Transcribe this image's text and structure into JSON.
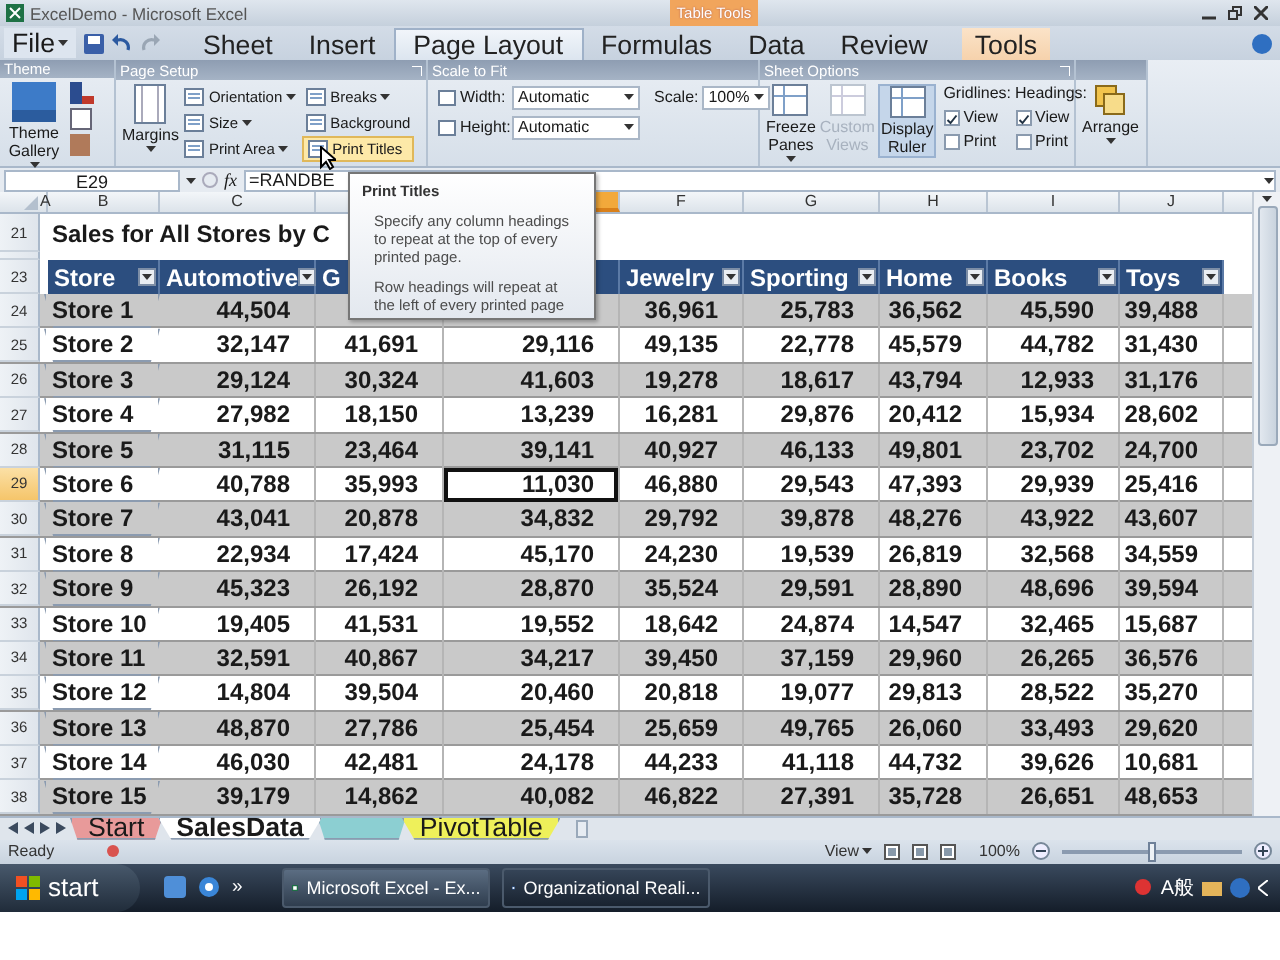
{
  "window": {
    "title": "ExcelDemo - Microsoft Excel",
    "context_label": "Table Tools"
  },
  "file_menu": "File",
  "tabs": [
    {
      "label": "Sheet",
      "kind": "normal",
      "selected": false
    },
    {
      "label": "Insert",
      "kind": "normal",
      "selected": false
    },
    {
      "label": "Page Layout",
      "kind": "normal",
      "selected": true
    },
    {
      "label": "Formulas",
      "kind": "normal",
      "selected": false
    },
    {
      "label": "Data",
      "kind": "normal",
      "selected": false
    },
    {
      "label": "Review",
      "kind": "normal",
      "selected": false
    },
    {
      "label": "Tools",
      "kind": "contextual",
      "selected": false
    }
  ],
  "ribbon": {
    "theme": {
      "label": "Theme",
      "gallery": "Theme Gallery"
    },
    "page_setup": {
      "label": "Page Setup",
      "margins": "Margins",
      "items": [
        {
          "label": "Orientation",
          "dropdown": true,
          "hovered": false
        },
        {
          "label": "Size",
          "dropdown": true,
          "hovered": false
        },
        {
          "label": "Print Area",
          "dropdown": true,
          "hovered": false
        },
        {
          "label": "Breaks",
          "dropdown": true,
          "hovered": false
        },
        {
          "label": "Background",
          "dropdown": false,
          "hovered": false
        },
        {
          "label": "Print Titles",
          "dropdown": false,
          "hovered": true
        }
      ]
    },
    "scale_to_fit": {
      "label": "Scale to Fit",
      "width_label": "Width:",
      "width": "Automatic",
      "height_label": "Height:",
      "height": "Automatic",
      "scale_label": "Scale:",
      "scale": "100%"
    },
    "sheet_options": {
      "label": "Sheet Options",
      "buttons": [
        {
          "label": "Freeze Panes",
          "dropdown": true,
          "disabled": false,
          "selected": false
        },
        {
          "label": "Custom Views",
          "dropdown": false,
          "disabled": true,
          "selected": false
        },
        {
          "label": "Display Ruler",
          "dropdown": false,
          "disabled": false,
          "selected": true
        }
      ],
      "gridlines": {
        "label": "Gridlines:",
        "view": {
          "label": "View",
          "checked": true
        },
        "print": {
          "label": "Print",
          "checked": false
        }
      },
      "headings": {
        "label": "Headings:",
        "view": {
          "label": "View",
          "checked": true
        },
        "print": {
          "label": "Print",
          "checked": false
        }
      }
    },
    "arrange": {
      "label": "Arrange"
    }
  },
  "formula_bar": {
    "name_box": "E29",
    "function_label": "fx",
    "formula": "=RANDBE"
  },
  "tooltip": {
    "title": "Print Titles",
    "paragraphs": [
      "Specify any column headings to repeat at the top of every printed page.",
      "Row headings will repeat at the left of every printed page"
    ]
  },
  "sheet": {
    "columns": [
      {
        "letter": "A",
        "selected": false
      },
      {
        "letter": "B",
        "header": "Store",
        "selected": false
      },
      {
        "letter": "C",
        "header": "Automotive",
        "selected": false
      },
      {
        "header": "G",
        "selected": false
      },
      {
        "selected": true
      },
      {
        "letter": "F",
        "header": "Jewelry",
        "selected": false
      },
      {
        "letter": "G",
        "header": "Sporting",
        "selected": false
      },
      {
        "letter": "H",
        "header": "Home",
        "selected": false
      },
      {
        "letter": "I",
        "header": "Books",
        "selected": false
      },
      {
        "letter": "J",
        "header": "Toys",
        "selected": false
      }
    ],
    "title_row": "21",
    "title": "Sales for All Stores by C",
    "header_row": "23",
    "rows": [
      {
        "number": "24",
        "selected": false,
        "covered_by_tooltip": true,
        "store": "Store 1",
        "values": [
          "44,504",
          "36,961",
          "25,783",
          "36,562",
          "45,590",
          "39,488"
        ]
      },
      {
        "number": "25",
        "selected": false,
        "store": "Store 2",
        "values": [
          "32,147",
          "41,691",
          "29,116",
          "49,135",
          "22,778",
          "45,579",
          "44,782",
          "31,430"
        ]
      },
      {
        "number": "26",
        "selected": false,
        "store": "Store 3",
        "values": [
          "29,124",
          "30,324",
          "41,603",
          "19,278",
          "18,617",
          "43,794",
          "12,933",
          "31,176"
        ]
      },
      {
        "number": "27",
        "selected": false,
        "store": "Store 4",
        "values": [
          "27,982",
          "18,150",
          "13,239",
          "16,281",
          "29,876",
          "20,412",
          "15,934",
          "28,602"
        ]
      },
      {
        "number": "28",
        "selected": false,
        "store": "Store 5",
        "values": [
          "31,115",
          "23,464",
          "39,141",
          "40,927",
          "46,133",
          "49,801",
          "23,702",
          "24,700"
        ]
      },
      {
        "number": "29",
        "selected": true,
        "store": "Store 6",
        "values": [
          "40,788",
          "35,993",
          "11,030",
          "46,880",
          "29,543",
          "47,393",
          "29,939",
          "25,416"
        ]
      },
      {
        "number": "30",
        "selected": false,
        "store": "Store 7",
        "values": [
          "43,041",
          "20,878",
          "34,832",
          "29,792",
          "39,878",
          "48,276",
          "43,922",
          "43,607"
        ]
      },
      {
        "number": "31",
        "selected": false,
        "store": "Store 8",
        "values": [
          "22,934",
          "17,424",
          "45,170",
          "24,230",
          "19,539",
          "26,819",
          "32,568",
          "34,559"
        ]
      },
      {
        "number": "32",
        "selected": false,
        "store": "Store 9",
        "values": [
          "45,323",
          "26,192",
          "28,870",
          "35,524",
          "29,591",
          "28,890",
          "48,696",
          "39,594"
        ]
      },
      {
        "number": "33",
        "selected": false,
        "store": "Store 10",
        "values": [
          "19,405",
          "41,531",
          "19,552",
          "18,642",
          "24,874",
          "14,547",
          "32,465",
          "15,687"
        ]
      },
      {
        "number": "34",
        "selected": false,
        "store": "Store 11",
        "values": [
          "32,591",
          "40,867",
          "34,217",
          "39,450",
          "37,159",
          "29,960",
          "26,265",
          "36,576"
        ]
      },
      {
        "number": "35",
        "selected": false,
        "store": "Store 12",
        "values": [
          "14,804",
          "39,504",
          "20,460",
          "20,818",
          "19,077",
          "29,813",
          "28,522",
          "35,270"
        ]
      },
      {
        "number": "36",
        "selected": false,
        "store": "Store 13",
        "values": [
          "48,870",
          "27,786",
          "25,454",
          "25,659",
          "49,765",
          "26,060",
          "33,493",
          "29,620"
        ]
      },
      {
        "number": "37",
        "selected": false,
        "store": "Store 14",
        "values": [
          "46,030",
          "42,481",
          "24,178",
          "44,233",
          "41,118",
          "44,732",
          "39,626",
          "10,681"
        ]
      },
      {
        "number": "38",
        "selected": false,
        "store": "Store 15",
        "values": [
          "39,179",
          "14,862",
          "40,082",
          "46,822",
          "27,391",
          "35,728",
          "26,651",
          "48,653"
        ]
      }
    ]
  },
  "sheet_tabs": [
    {
      "label": "Start",
      "color": "#e89a9a",
      "selected": false
    },
    {
      "label": "SalesData",
      "color": "#ffffff",
      "selected": true
    },
    {
      "color": "#8ccfd2",
      "selected": false
    },
    {
      "label": "PivotTable",
      "color": "#eef05a",
      "selected": false
    }
  ],
  "status_bar": {
    "text": "Ready",
    "view_label": "View",
    "zoom": "100%",
    "zoom_slider": {
      "level": 0.5
    }
  },
  "taskbar": {
    "start": "start",
    "overflow": "»",
    "windows": [
      {
        "label": "Microsoft Excel - Ex...",
        "selected": true
      },
      {
        "label": "Organizational Reali...",
        "selected": false
      }
    ],
    "tray_label": "A般"
  }
}
